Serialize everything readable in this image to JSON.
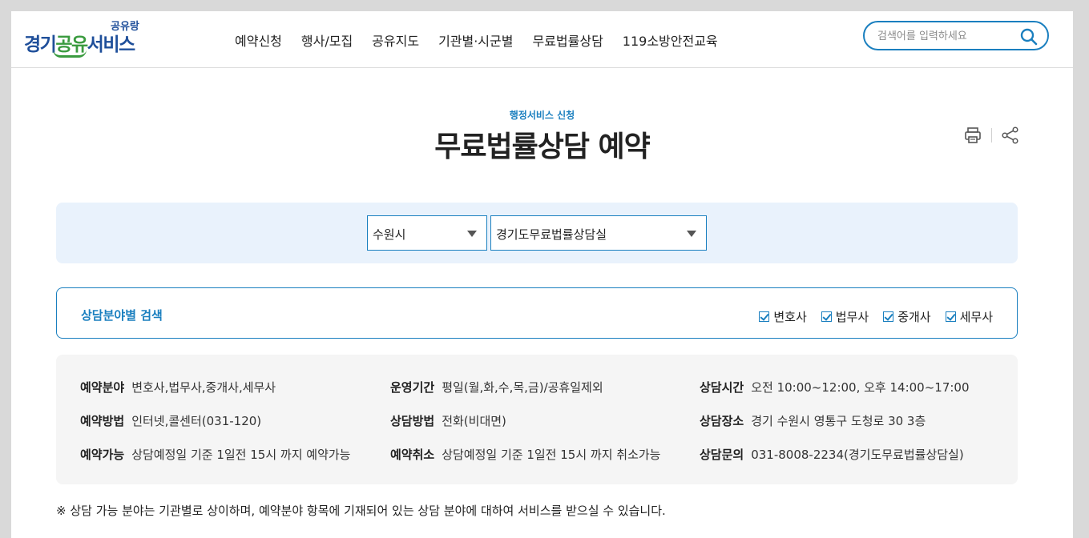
{
  "logo": {
    "sub_text": "공유랑",
    "main_part1": "경기",
    "main_part2": "공유",
    "main_part3": "서비스"
  },
  "nav": {
    "items": [
      {
        "label": "예약신청"
      },
      {
        "label": "행사/모집"
      },
      {
        "label": "공유지도"
      },
      {
        "label": "기관별·시군별"
      },
      {
        "label": "무료법률상담"
      },
      {
        "label": "119소방안전교육"
      }
    ]
  },
  "search": {
    "placeholder": "검색어를 입력하세요",
    "icon": "search-icon"
  },
  "page": {
    "eyebrow": "행정서비스 신청",
    "title": "무료법률상담 예약"
  },
  "tools": {
    "print_icon": "print-icon",
    "share_icon": "share-icon"
  },
  "selects": {
    "city": "수원시",
    "office": "경기도무료법률상담실"
  },
  "filter": {
    "label": "상담분야별 검색",
    "options": [
      {
        "label": "변호사",
        "checked": true
      },
      {
        "label": "법무사",
        "checked": true
      },
      {
        "label": "중개사",
        "checked": true
      },
      {
        "label": "세무사",
        "checked": true
      }
    ]
  },
  "info": {
    "reserve_field": {
      "key": "예약분야",
      "value": "변호사,법무사,중개사,세무사"
    },
    "operating_period": {
      "key": "운영기간",
      "value": "평일(월,화,수,목,금)/공휴일제외"
    },
    "consult_time": {
      "key": "상담시간",
      "value": "오전 10:00~12:00, 오후 14:00~17:00"
    },
    "reserve_method": {
      "key": "예약방법",
      "value": "인터넷,콜센터(031-120)"
    },
    "consult_method": {
      "key": "상담방법",
      "value": "전화(비대면)"
    },
    "consult_place": {
      "key": "상담장소",
      "value": "경기 수원시 영통구 도청로 30  3층"
    },
    "reserve_available": {
      "key": "예약가능",
      "value": "상담예정일 기준 1일전 15시 까지 예약가능"
    },
    "reserve_cancel": {
      "key": "예약취소",
      "value": "상담예정일 기준 1일전 15시 까지 취소가능"
    },
    "consult_inquiry": {
      "key": "상담문의",
      "value": "031-8008-2234(경기도무료법률상담실)"
    }
  },
  "notice": "※ 상담 가능 분야는 기관별로 상이하며, 예약분야 항목에 기재되어 있는 상담 분야에 대하여 서비스를 받으실 수 있습니다.",
  "colors": {
    "accent": "#1a7fbf",
    "brand_blue": "#1f4f9a",
    "brand_green": "#3a9b3f",
    "select_panel_bg": "#e9f2fc",
    "info_panel_bg": "#f5f5f5"
  }
}
